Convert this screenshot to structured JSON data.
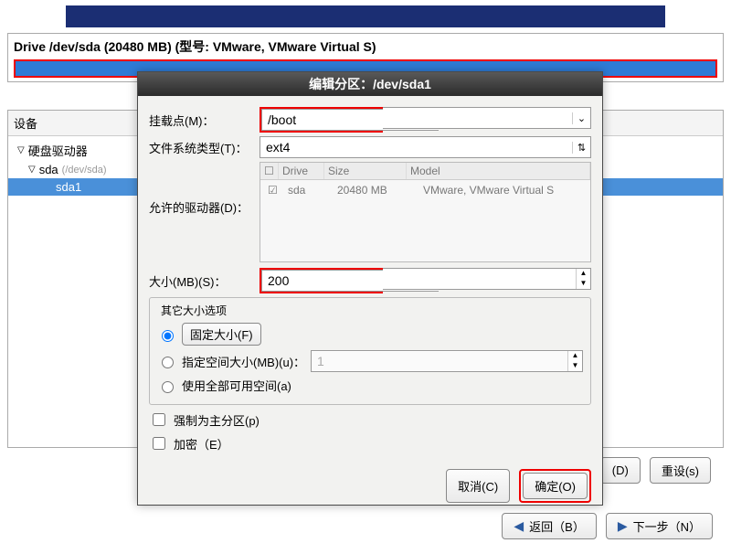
{
  "top": {},
  "drive": {
    "title": "Drive /dev/sda (20480 MB) (型号: VMware, VMware Virtual S)"
  },
  "tree": {
    "header": "设备",
    "root": "硬盘驱动器",
    "node": "sda",
    "node_dev": "(/dev/sda)",
    "leaf": "sda1"
  },
  "dialog": {
    "title": "编辑分区：/dev/sda1",
    "mount_label": "挂载点(M)：",
    "mount_value": "/boot",
    "fstype_label": "文件系统类型(T)：",
    "fstype_value": "ext4",
    "drives_label": "允许的驱动器(D)：",
    "drive_headers": {
      "d": "Drive",
      "s": "Size",
      "m": "Model",
      "chk": "☑"
    },
    "drive_row": {
      "name": "sda",
      "size": "20480 MB",
      "model": "VMware, VMware Virtual S"
    },
    "size_label": "大小(MB)(S)：",
    "size_value": "200",
    "group_title": "其它大小选项",
    "radio_fixed": "固定大小(F)",
    "radio_fill_label": "指定空间大小(MB)(u)：",
    "radio_fill_value": "1",
    "radio_all": "使用全部可用空间(a)",
    "chk_primary": "强制为主分区(p)",
    "chk_encrypt": "加密（E）",
    "cancel": "取消(C)",
    "ok": "确定(O)"
  },
  "side": {
    "d": "(D)",
    "reset": "重设(s)"
  },
  "footer": {
    "back": "返回（B）",
    "next": "下一步（N）"
  },
  "chk_glyph": "☑",
  "colors": {
    "highlight": "#e00000"
  }
}
